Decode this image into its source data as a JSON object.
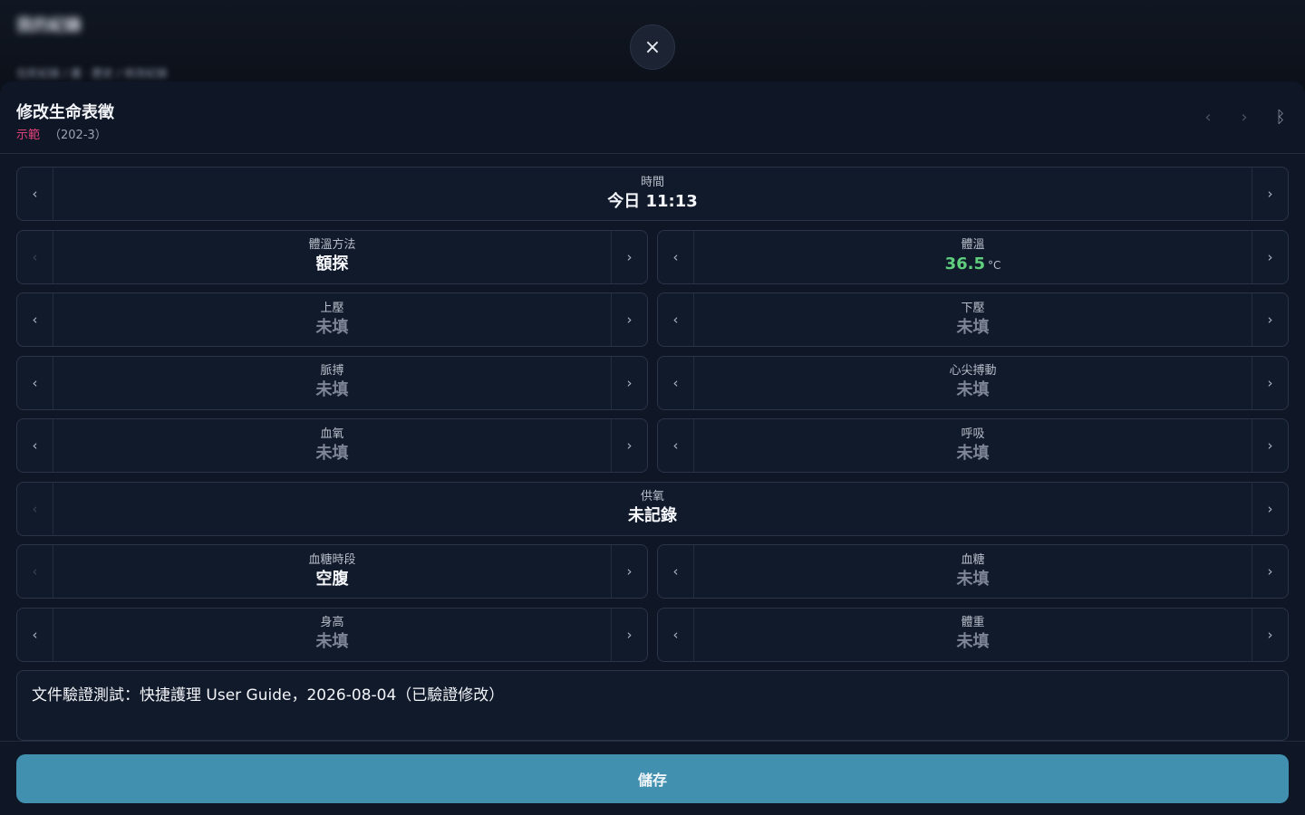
{
  "backdrop": {
    "title": "我的紀錄",
    "breadcrumb": "住民紀錄 / 護 · 歷史 / 修改紀錄"
  },
  "close_icon": "×",
  "sheet": {
    "title": "修改生命表徵",
    "demo_label": "示範",
    "room": "（202-3）",
    "icons": {
      "prev": "‹",
      "next": "›",
      "bluetooth": "ᛒ"
    }
  },
  "fields": {
    "time": {
      "label": "時間",
      "value": "今日 11:13"
    },
    "temp_method": {
      "label": "體溫方法",
      "value": "額探"
    },
    "temperature": {
      "label": "體溫",
      "value": "36.5",
      "unit": "°C"
    },
    "systolic": {
      "label": "上壓",
      "value": "未填"
    },
    "diastolic": {
      "label": "下壓",
      "value": "未填"
    },
    "pulse": {
      "label": "脈搏",
      "value": "未填"
    },
    "apical": {
      "label": "心尖搏動",
      "value": "未填"
    },
    "spo2": {
      "label": "血氧",
      "value": "未填"
    },
    "respiration": {
      "label": "呼吸",
      "value": "未填"
    },
    "oxygen": {
      "label": "供氧",
      "value": "未記錄"
    },
    "glucose_period": {
      "label": "血糖時段",
      "value": "空腹"
    },
    "glucose": {
      "label": "血糖",
      "value": "未填"
    },
    "height": {
      "label": "身高",
      "value": "未填"
    },
    "weight": {
      "label": "體重",
      "value": "未填"
    }
  },
  "note": "文件驗證測試：快捷護理 User Guide，2026-08-04（已驗證修改）",
  "save_label": "儲存",
  "arrows": {
    "left": "‹",
    "right": "›"
  },
  "colors": {
    "accent": "#4190b0",
    "demo": "#e0417a",
    "ok": "#5fcf7d"
  }
}
